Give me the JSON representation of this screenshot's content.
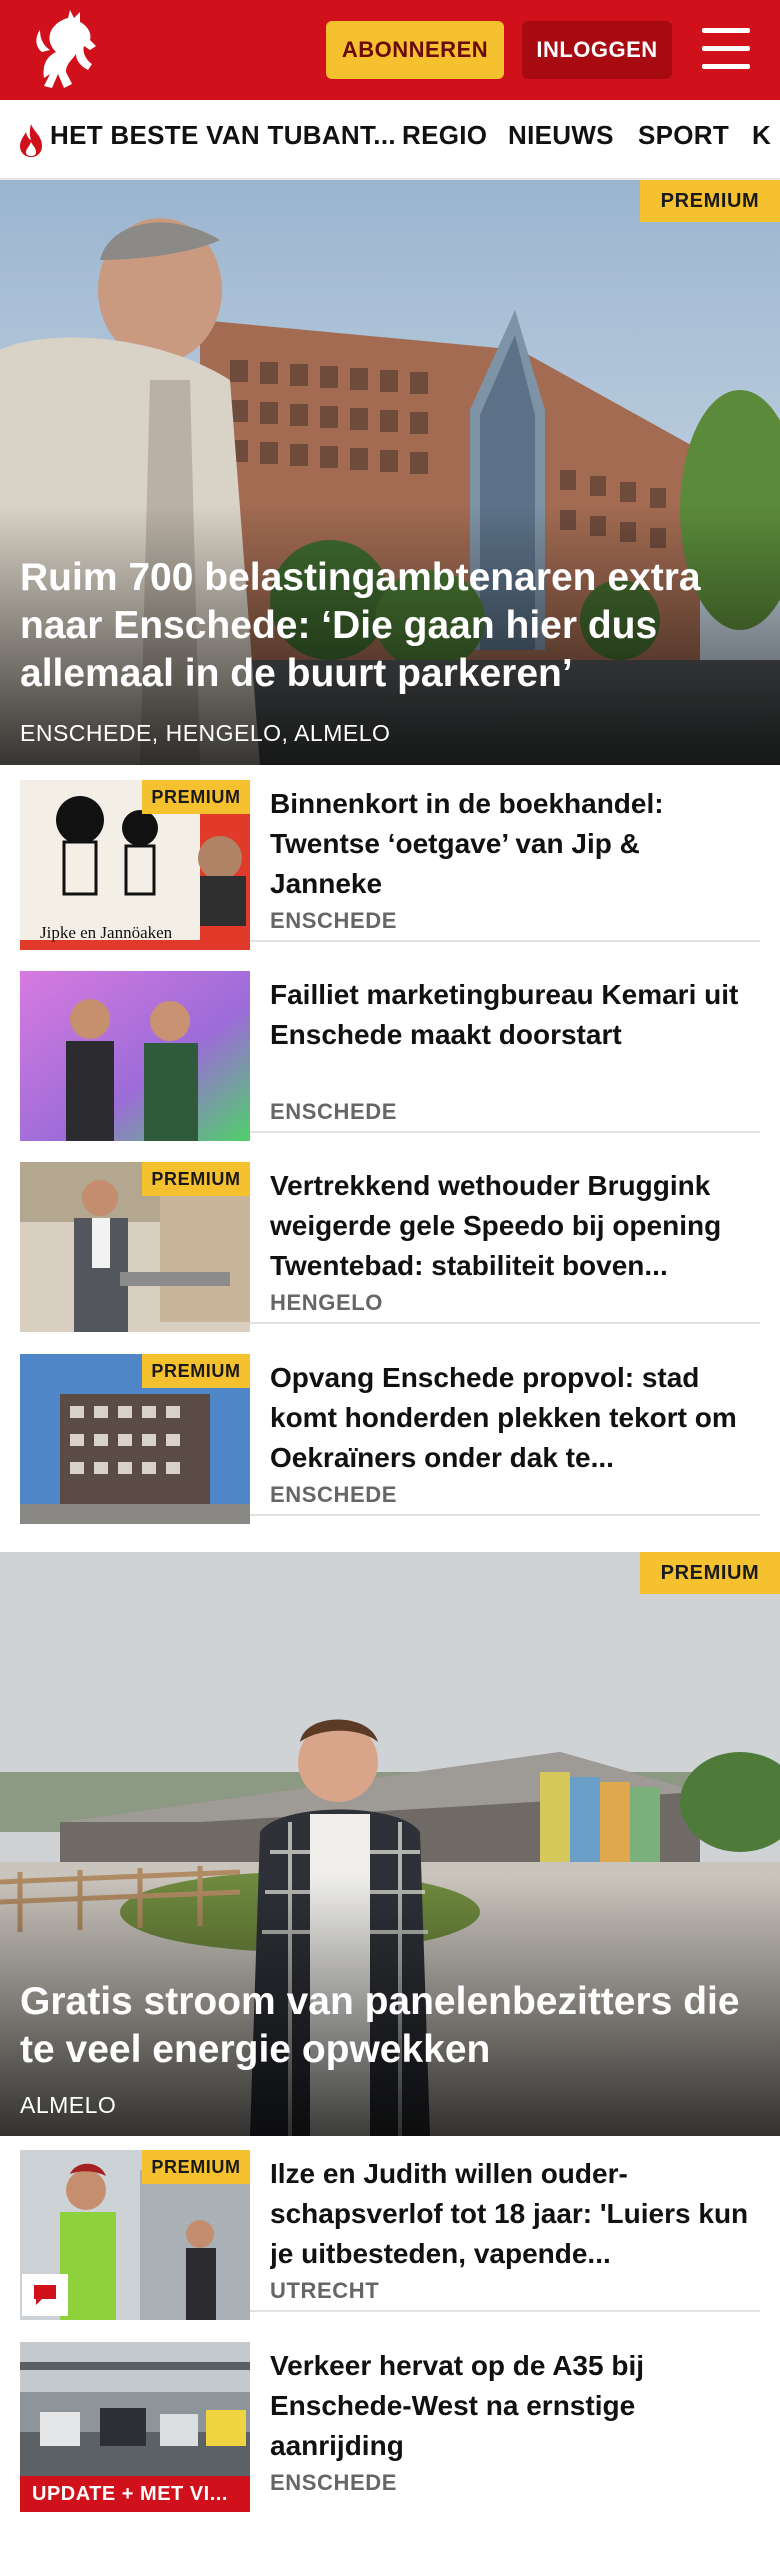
{
  "header": {
    "subscribe_label": "ABONNEREN",
    "login_label": "INLOGGEN",
    "brand_color": "#d0101b",
    "accent_color": "#f6c12f"
  },
  "nav": {
    "items": [
      {
        "label": "HET BESTE VAN TUBANT...",
        "icon": "flame-icon"
      },
      {
        "label": "REGIO"
      },
      {
        "label": "NIEUWS"
      },
      {
        "label": "SPORT"
      },
      {
        "label": "K"
      }
    ]
  },
  "hero1": {
    "badge": "PREMIUM",
    "title": "Ruim 700 belastingambtenaren extra naar Enschede: ‘Die gaan hier dus allemaal in de buurt parkeren’",
    "tag": "ENSCHEDE, HENGELO, ALMELO"
  },
  "articles1": [
    {
      "badge": "PREMIUM",
      "title": "Binnenkort in de boekhandel: Twentse ‘oetgave’ van Jip & Janneke",
      "tag": "ENSCHEDE",
      "thumb_caption": "Jipke en Jannöaken"
    },
    {
      "badge": "",
      "title": "Failliet marketingbureau Kemari uit Enschede maakt doorstart",
      "tag": "ENSCHEDE"
    },
    {
      "badge": "PREMIUM",
      "title": "Vertrekkend wethouder Bruggink weigerde gele Speedo bij opening Twentebad: stabiliteit boven...",
      "tag": "HENGELO"
    },
    {
      "badge": "PREMIUM",
      "title": "Opvang Enschede propvol: stad komt honderden plekken tekort om Oekraïners onder dak te...",
      "tag": "ENSCHEDE"
    }
  ],
  "hero2": {
    "badge": "PREMIUM",
    "title": "Gratis stroom van panelenbezitters die te veel energie opwekken",
    "tag": "ALMELO"
  },
  "articles2": [
    {
      "badge": "PREMIUM",
      "title": "Ilze en Judith willen ouder-schapsverlof tot 18 jaar: 'Luiers kun je uitbesteden, vapende...",
      "tag": "UTRECHT",
      "icon": "comment-icon"
    },
    {
      "badge": "UPDATE + MET VI...",
      "title": "Verkeer hervat op de A35 bij Enschede-West na ernstige aanrijding",
      "tag": "ENSCHEDE"
    }
  ]
}
